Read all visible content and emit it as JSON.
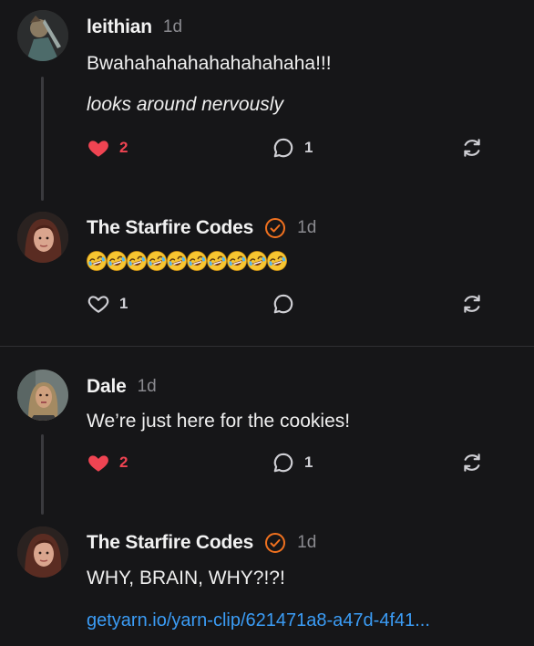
{
  "posts": [
    {
      "author": "leithian",
      "time": "1d",
      "lines": [
        "Bwahahahahahahahahaha!!!",
        "looks around nervously"
      ],
      "likes": "2",
      "liked": true,
      "replies": "1"
    },
    {
      "author": "The Starfire Codes",
      "verified": true,
      "time": "1d",
      "emoji": "rolling-on-floor-laughing-emoji",
      "emoji_count": 10,
      "likes": "1",
      "liked": false
    },
    {
      "author": "Dale",
      "time": "1d",
      "lines": [
        "We’re just here for the cookies!"
      ],
      "likes": "2",
      "liked": true,
      "replies": "1"
    },
    {
      "author": "The Starfire Codes",
      "verified": true,
      "time": "1d",
      "lines": [
        "WHY, BRAIN, WHY?!?!"
      ],
      "link": "getyarn.io/yarn-clip/621471a8-a47d-4f41..."
    }
  ],
  "colors": {
    "background": "#161618",
    "like_active": "#ef4452",
    "link": "#3b9cf5",
    "verified_badge": "#f0711f",
    "muted": "#8a8a8f"
  }
}
